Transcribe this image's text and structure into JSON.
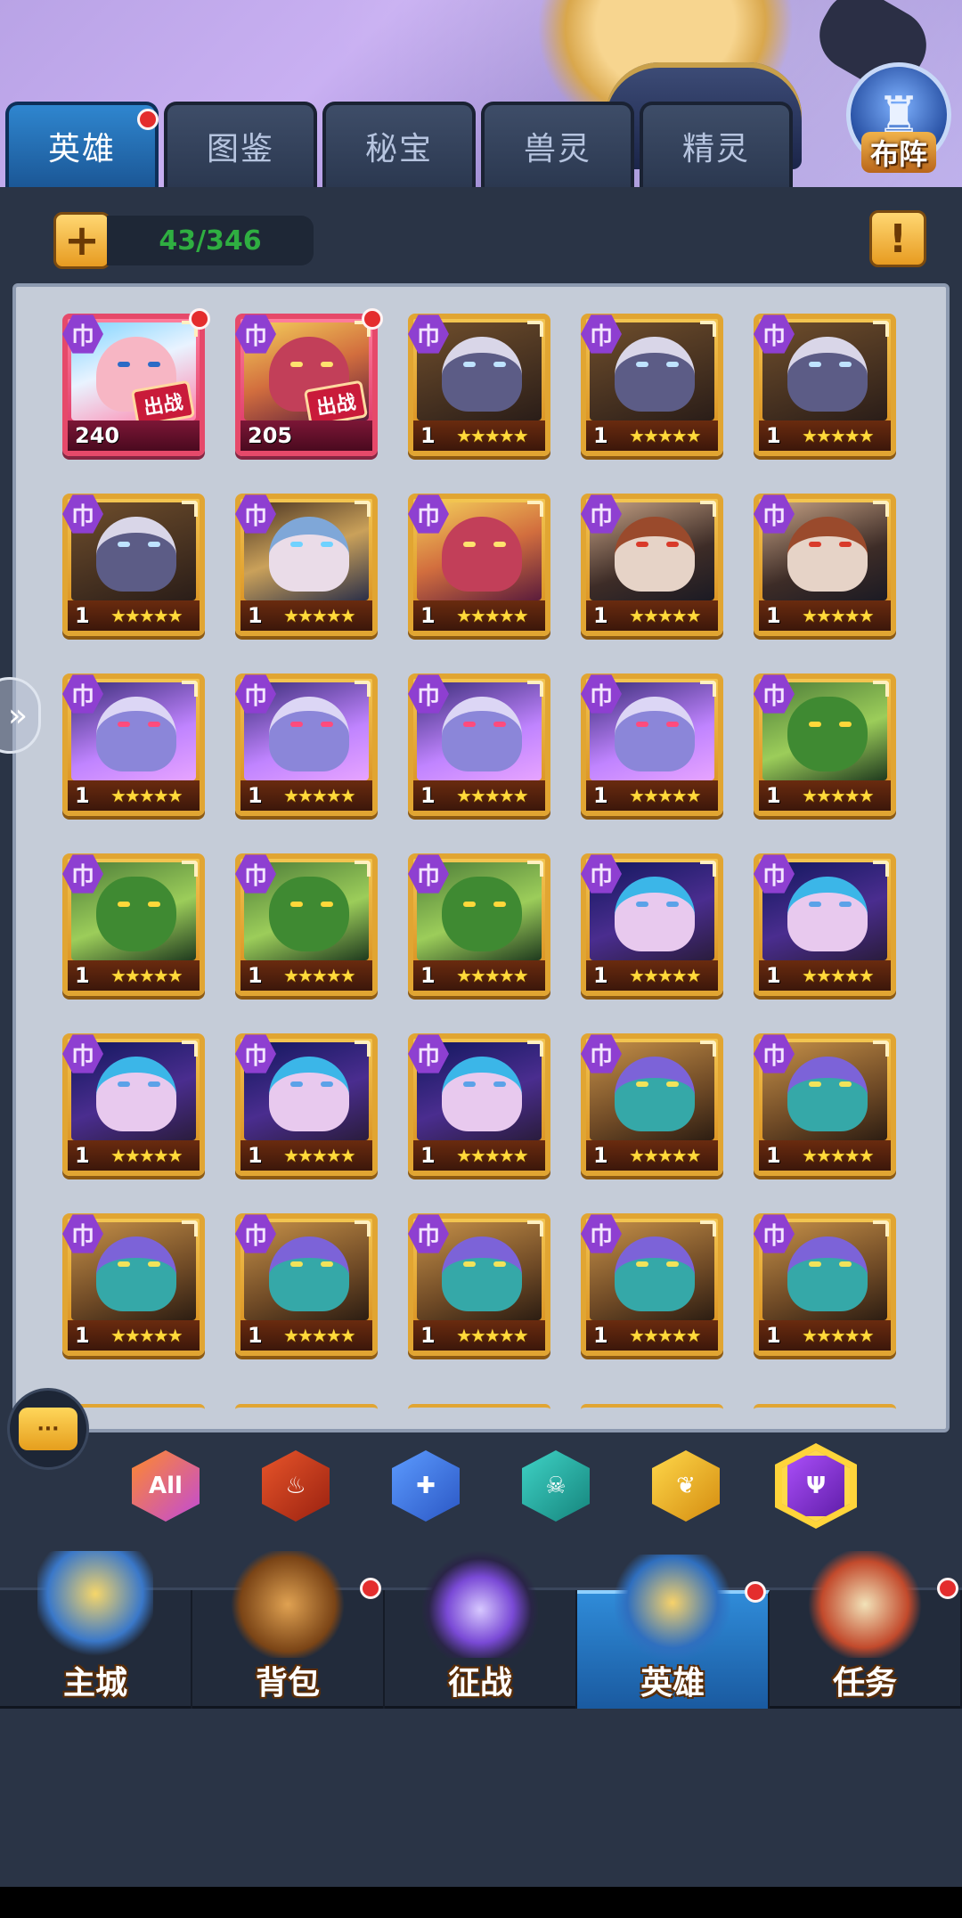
{
  "tabs": [
    {
      "label": "英雄",
      "active": true,
      "notification": true
    },
    {
      "label": "图鉴",
      "active": false,
      "notification": false
    },
    {
      "label": "秘宝",
      "active": false,
      "notification": false
    },
    {
      "label": "兽灵",
      "active": false,
      "notification": false
    },
    {
      "label": "精灵",
      "active": false,
      "notification": false
    }
  ],
  "formation_button": {
    "label": "布阵"
  },
  "hero_count": "43/346",
  "info_button": {
    "label": "!"
  },
  "add_button": {
    "label": "+"
  },
  "faction_glyph": "巾",
  "deploy_tag": "出战",
  "star_glyph": "★★★★★",
  "heroes": [
    {
      "portrait": "naga",
      "level": "240",
      "deployed": true,
      "notification": true
    },
    {
      "portrait": "mask",
      "level": "205",
      "deployed": true,
      "notification": true
    },
    {
      "portrait": "drow",
      "level": "1",
      "stars": 5
    },
    {
      "portrait": "drow",
      "level": "1",
      "stars": 5
    },
    {
      "portrait": "drow",
      "level": "1",
      "stars": 5
    },
    {
      "portrait": "drow",
      "level": "1",
      "stars": 5
    },
    {
      "portrait": "gold",
      "level": "1",
      "stars": 5
    },
    {
      "portrait": "mask",
      "level": "1",
      "stars": 5
    },
    {
      "portrait": "samurai",
      "level": "1",
      "stars": 5
    },
    {
      "portrait": "samurai",
      "level": "1",
      "stars": 5
    },
    {
      "portrait": "elf",
      "level": "1",
      "stars": 5
    },
    {
      "portrait": "elf",
      "level": "1",
      "stars": 5
    },
    {
      "portrait": "elf",
      "level": "1",
      "stars": 5
    },
    {
      "portrait": "elf",
      "level": "1",
      "stars": 5
    },
    {
      "portrait": "toad",
      "level": "1",
      "stars": 5
    },
    {
      "portrait": "toad",
      "level": "1",
      "stars": 5
    },
    {
      "portrait": "toad",
      "level": "1",
      "stars": 5
    },
    {
      "portrait": "toad",
      "level": "1",
      "stars": 5
    },
    {
      "portrait": "witch",
      "level": "1",
      "stars": 5
    },
    {
      "portrait": "witch",
      "level": "1",
      "stars": 5
    },
    {
      "portrait": "witch",
      "level": "1",
      "stars": 5
    },
    {
      "portrait": "witch",
      "level": "1",
      "stars": 5
    },
    {
      "portrait": "witch",
      "level": "1",
      "stars": 5
    },
    {
      "portrait": "medusa",
      "level": "1",
      "stars": 5
    },
    {
      "portrait": "medusa",
      "level": "1",
      "stars": 5
    },
    {
      "portrait": "medusa",
      "level": "1",
      "stars": 5
    },
    {
      "portrait": "medusa",
      "level": "1",
      "stars": 5
    },
    {
      "portrait": "medusa",
      "level": "1",
      "stars": 5
    },
    {
      "portrait": "medusa",
      "level": "1",
      "stars": 5
    },
    {
      "portrait": "medusa",
      "level": "1",
      "stars": 5
    }
  ],
  "filters": [
    {
      "id": "all",
      "label": "All",
      "selected": false
    },
    {
      "id": "fire",
      "label": "",
      "icon": "flame-icon",
      "selected": false
    },
    {
      "id": "holy",
      "label": "",
      "icon": "cross-icon",
      "selected": false
    },
    {
      "id": "undead",
      "label": "",
      "icon": "skull-icon",
      "selected": false
    },
    {
      "id": "nature",
      "label": "",
      "icon": "leaf-icon",
      "selected": false
    },
    {
      "id": "dark",
      "label": "",
      "icon": "trident-icon",
      "selected": true
    }
  ],
  "bottom_nav": [
    {
      "label": "主城",
      "icon": "castle-icon",
      "active": false,
      "notification": false
    },
    {
      "label": "背包",
      "icon": "chest-icon",
      "active": false,
      "notification": true
    },
    {
      "label": "征战",
      "icon": "dragon-portal-icon",
      "active": false,
      "notification": false
    },
    {
      "label": "英雄",
      "icon": "helmet-icon",
      "active": true,
      "notification": true
    },
    {
      "label": "任务",
      "icon": "scroll-icon",
      "active": false,
      "notification": true
    }
  ],
  "chat_button": {
    "label": "···"
  }
}
